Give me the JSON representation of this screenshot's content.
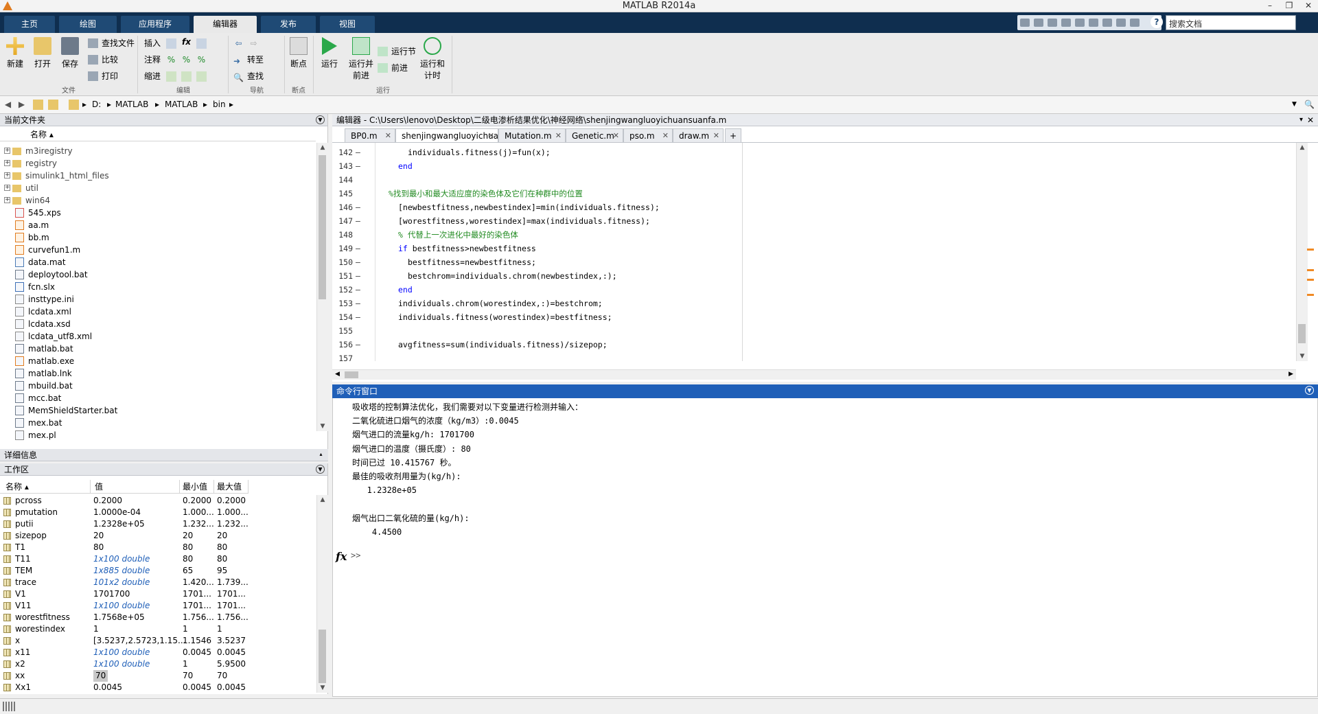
{
  "window": {
    "title": "MATLAB R2014a",
    "controls": [
      "–",
      "❐",
      "✕"
    ]
  },
  "ribbon_tabs": [
    "主页",
    "绘图",
    "应用程序",
    "编辑器",
    "发布",
    "视图"
  ],
  "search": {
    "placeholder": "搜索文档"
  },
  "ribbon": {
    "file_group": {
      "label": "文件",
      "new": "新建",
      "open": "打开",
      "save": "保存",
      "find_files": "查找文件",
      "compare": "比较",
      "print": "打印"
    },
    "edit_group": {
      "label": "编辑",
      "insert": "插入",
      "comment": "注释",
      "indent": "缩进"
    },
    "nav_group": {
      "label": "导航",
      "goto": "转至",
      "find": "查找"
    },
    "breakpoints_group": {
      "label": "断点",
      "breakpoints": "断点"
    },
    "run_group": {
      "label": "运行",
      "run": "运行",
      "run_advance_1": "运行并",
      "run_advance_2": "前进",
      "run_section": "运行节",
      "advance": "前进",
      "run_time_1": "运行和",
      "run_time_2": "计时"
    }
  },
  "address": {
    "crumbs": [
      "D:",
      "MATLAB",
      "MATLAB",
      "bin"
    ]
  },
  "current_folder": {
    "title": "当前文件夹",
    "column_name": "名称",
    "folders": [
      "m3iregistry",
      "registry",
      "simulink1_html_files",
      "util",
      "win64"
    ],
    "files": [
      "545.xps",
      "aa.m",
      "bb.m",
      "curvefun1.m",
      "data.mat",
      "deploytool.bat",
      "fcn.slx",
      "insttype.ini",
      "lcdata.xml",
      "lcdata.xsd",
      "lcdata_utf8.xml",
      "matlab.bat",
      "matlab.exe",
      "matlab.lnk",
      "mbuild.bat",
      "mcc.bat",
      "MemShieldStarter.bat",
      "mex.bat",
      "mex.pl"
    ]
  },
  "details": {
    "title": "详细信息"
  },
  "workspace": {
    "title": "工作区",
    "headers": {
      "name": "名称",
      "value": "值",
      "min": "最小值",
      "max": "最大值"
    },
    "rows": [
      {
        "name": "pcross",
        "value": "0.2000",
        "min": "0.2000",
        "max": "0.2000"
      },
      {
        "name": "pmutation",
        "value": "1.0000e-04",
        "min": "1.000...",
        "max": "1.000..."
      },
      {
        "name": "putii",
        "value": "1.2328e+05",
        "min": "1.232...",
        "max": "1.232..."
      },
      {
        "name": "sizepop",
        "value": "20",
        "min": "20",
        "max": "20"
      },
      {
        "name": "T1",
        "value": "80",
        "min": "80",
        "max": "80"
      },
      {
        "name": "T11",
        "value": "1x100 double",
        "min": "80",
        "max": "80"
      },
      {
        "name": "TEM",
        "value": "1x885 double",
        "min": "65",
        "max": "95"
      },
      {
        "name": "trace",
        "value": "101x2 double",
        "min": "1.420...",
        "max": "1.739..."
      },
      {
        "name": "V1",
        "value": "1701700",
        "min": "1701...",
        "max": "1701..."
      },
      {
        "name": "V11",
        "value": "1x100 double",
        "min": "1701...",
        "max": "1701..."
      },
      {
        "name": "worestfitness",
        "value": "1.7568e+05",
        "min": "1.756...",
        "max": "1.756..."
      },
      {
        "name": "worestindex",
        "value": "1",
        "min": "1",
        "max": "1"
      },
      {
        "name": "x",
        "value": "[3.5237,2.5723,1.15...",
        "min": "1.1546",
        "max": "3.5237"
      },
      {
        "name": "x11",
        "value": "1x100 double",
        "min": "0.0045",
        "max": "0.0045"
      },
      {
        "name": "x2",
        "value": "1x100 double",
        "min": "1",
        "max": "5.9500"
      },
      {
        "name": "xx",
        "value": "70",
        "min": "70",
        "max": "70"
      },
      {
        "name": "Xx1",
        "value": "0.0045",
        "min": "0.0045",
        "max": "0.0045"
      }
    ]
  },
  "editor": {
    "title": "编辑器 - C:\\Users\\lenovo\\Desktop\\二级电渗析结果优化\\神经网络\\shenjingwangluoyichuansuanfa.m",
    "tabs": [
      "BP0.m",
      "shenjingwangluoyichuansuanfa.m",
      "Mutation.m",
      "Genetic.m",
      "pso.m",
      "draw.m"
    ],
    "active_tab": "shenjingwangluoyichuansuanfa.m",
    "lines": [
      {
        "n": "142",
        "dash": "–",
        "text": "individuals.fitness(j)=fun(x);",
        "indent": 3,
        "style": ""
      },
      {
        "n": "143",
        "dash": "–",
        "text": "end",
        "indent": 2,
        "style": "kw"
      },
      {
        "n": "144",
        "dash": "",
        "text": "",
        "indent": 0,
        "style": ""
      },
      {
        "n": "145",
        "dash": "",
        "text": "%找到最小和最大适应度的染色体及它们在种群中的位置",
        "indent": 1,
        "style": "cm"
      },
      {
        "n": "146",
        "dash": "–",
        "text": "[newbestfitness,newbestindex]=min(individuals.fitness);",
        "indent": 2,
        "style": ""
      },
      {
        "n": "147",
        "dash": "–",
        "text": "[worestfitness,worestindex]=max(individuals.fitness);",
        "indent": 2,
        "style": ""
      },
      {
        "n": "148",
        "dash": "",
        "text": "% 代替上一次进化中最好的染色体",
        "indent": 2,
        "style": "cm"
      },
      {
        "n": "149",
        "dash": "–",
        "text": "if bestfitness>newbestfitness",
        "indent": 2,
        "style": "if"
      },
      {
        "n": "150",
        "dash": "–",
        "text": "bestfitness=newbestfitness;",
        "indent": 3,
        "style": ""
      },
      {
        "n": "151",
        "dash": "–",
        "text": "bestchrom=individuals.chrom(newbestindex,:);",
        "indent": 3,
        "style": ""
      },
      {
        "n": "152",
        "dash": "–",
        "text": "end",
        "indent": 2,
        "style": "kw"
      },
      {
        "n": "153",
        "dash": "–",
        "text": "individuals.chrom(worestindex,:)=bestchrom;",
        "indent": 2,
        "style": ""
      },
      {
        "n": "154",
        "dash": "–",
        "text": "individuals.fitness(worestindex)=bestfitness;",
        "indent": 2,
        "style": ""
      },
      {
        "n": "155",
        "dash": "",
        "text": "",
        "indent": 0,
        "style": ""
      },
      {
        "n": "156",
        "dash": "–",
        "text": "avgfitness=sum(individuals.fitness)/sizepop;",
        "indent": 2,
        "style": ""
      },
      {
        "n": "157",
        "dash": "",
        "text": "",
        "indent": 0,
        "style": ""
      }
    ]
  },
  "command_window": {
    "title": "命令行窗口",
    "lines": [
      "吸收塔的控制算法优化，我们需要对以下变量进行检测并输入：",
      "二氧化硫进口烟气的浓度（kg/m3）:0.0045",
      "烟气进口的流量kg/h: 1701700",
      "烟气进口的温度（摄氏度）: 80",
      "时间已过 10.415767 秒。",
      "最佳的吸收剂用量为(kg/h):",
      "   1.2328e+05",
      "",
      "烟气出口二氧化硫的量(kg/h):",
      "    4.4500"
    ],
    "prompt_icon": "fx",
    "prompt": ">>"
  },
  "colors": {
    "tab_bar": "#0f2e4f",
    "accent": "#1f5fb8",
    "comment": "#228b22",
    "keyword": "#0000ff",
    "marker": "#f08a24"
  }
}
